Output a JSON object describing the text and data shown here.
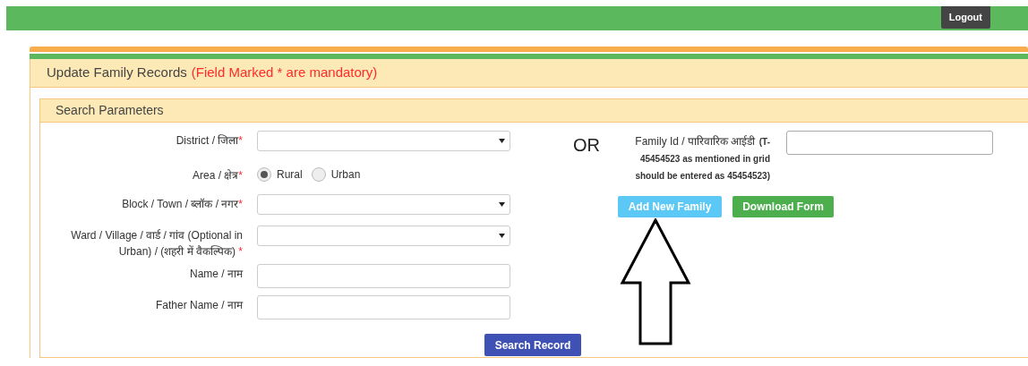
{
  "top_bar": {
    "logout": "Logout"
  },
  "panel": {
    "title": "Update Family Records",
    "note": "(Field Marked * are mandatory)",
    "search": {
      "title": "Search Parameters",
      "fields": [
        {
          "kind": "select",
          "label": "District / जिला",
          "mark": "*"
        },
        {
          "kind": "radio",
          "label": "Area / क्षेत्र",
          "mark": "*",
          "options": [
            {
              "label": "Rural",
              "selected": true
            },
            {
              "label": "Urban",
              "selected": false
            }
          ]
        },
        {
          "kind": "select",
          "label": "Block / Town / ब्लॉक / नगर",
          "mark": "*"
        },
        {
          "kind": "select",
          "label": "Ward / Village / वार्ड / गांव (Optional in Urban) / (शहरी में वैकल्पिक)",
          "mark": "*"
        },
        {
          "kind": "text",
          "label": "Name / नाम"
        },
        {
          "kind": "text",
          "label": "Father Name / नाम"
        }
      ],
      "search_button": "Search Record",
      "or": "OR",
      "family_id": {
        "label": "Family Id / पारिवारिक आईडी",
        "note": "(T-45454523 as mentioned in grid should be entered as 45454523)"
      },
      "buttons": [
        {
          "label": "Add New Family",
          "kind": "info"
        },
        {
          "label": "Download Form",
          "kind": "success"
        }
      ]
    }
  }
}
